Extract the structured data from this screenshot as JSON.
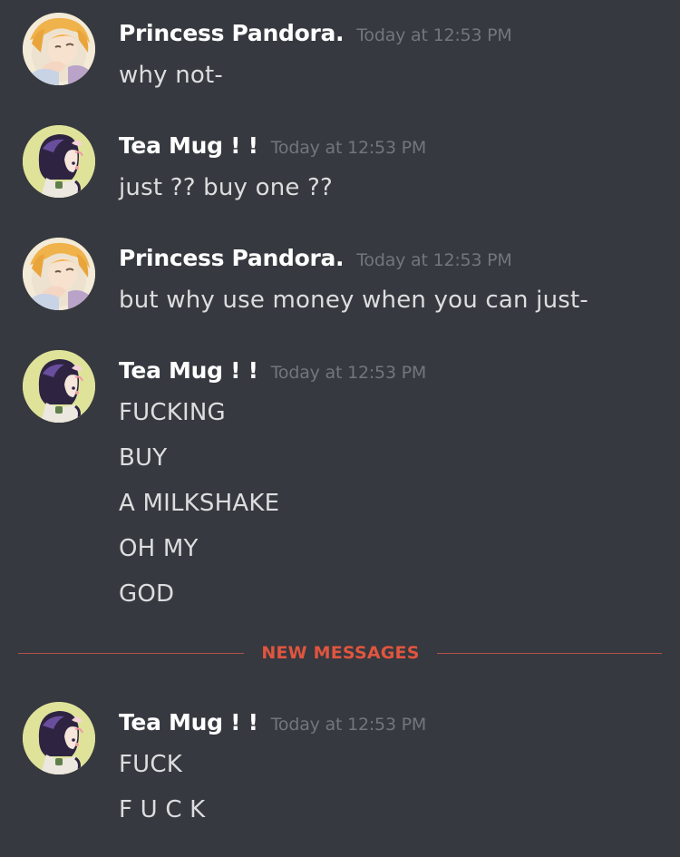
{
  "divider": {
    "label": "NEW MESSAGES"
  },
  "messages": [
    {
      "author": "Princess Pandora.",
      "time": "Today at 12:53 PM",
      "lines": [
        "why not-"
      ]
    },
    {
      "author": "Tea Mug ! !",
      "time": "Today at 12:53 PM",
      "lines": [
        "just ?? buy one ??"
      ]
    },
    {
      "author": "Princess Pandora.",
      "time": "Today at 12:53 PM",
      "lines": [
        "but why use money when you can just-"
      ]
    },
    {
      "author": "Tea Mug ! !",
      "time": "Today at 12:53 PM",
      "lines": [
        "FUCKING",
        "BUY",
        "A MILKSHAKE",
        "OH MY",
        "GOD"
      ]
    },
    {
      "author": "Tea Mug ! !",
      "time": "Today at 12:53 PM",
      "lines": [
        "FUCK",
        "F U C K"
      ]
    }
  ],
  "colors": {
    "background": "#36393f",
    "username": "#ffffff",
    "timestamp": "#72767d",
    "message_text": "#dcddde",
    "new_messages_accent": "#e0553f"
  }
}
